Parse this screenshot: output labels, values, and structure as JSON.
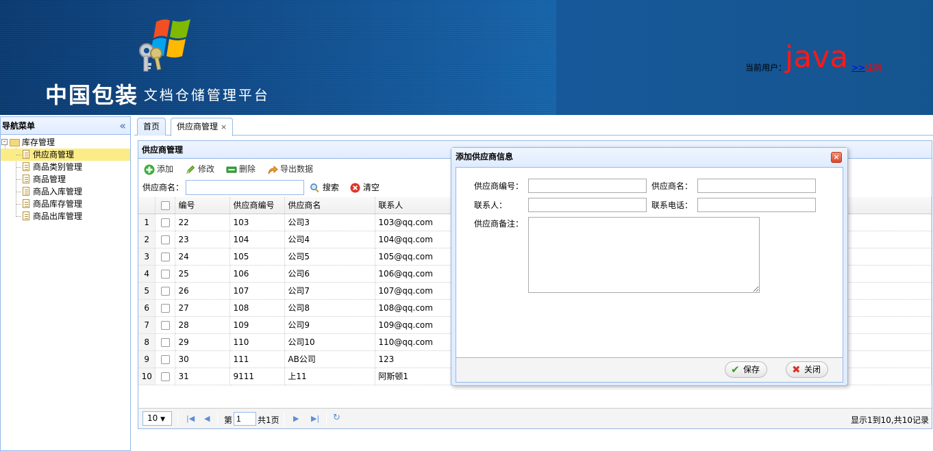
{
  "header": {
    "brand_big": "中国包装",
    "brand_small": "文档仓储管理平台",
    "user_label": "当前用户：",
    "user_name": "java",
    "logout_arrow": ">>",
    "logout_text": "注销"
  },
  "sidebar": {
    "title": "导航菜单",
    "collapse_icon": "double-chevron-left-icon",
    "root": {
      "label": "库存管理",
      "toggle": "-"
    },
    "items": [
      {
        "label": "供应商管理",
        "selected": true
      },
      {
        "label": "商品类别管理"
      },
      {
        "label": "商品管理"
      },
      {
        "label": "商品入库管理"
      },
      {
        "label": "商品库存管理"
      },
      {
        "label": "商品出库管理"
      }
    ]
  },
  "tabs": [
    {
      "label": "首页"
    },
    {
      "label": "供应商管理",
      "closable": "×"
    }
  ],
  "panel": {
    "title": "供应商管理",
    "toolbar": {
      "add": "添加",
      "edit": "修改",
      "delete": "删除",
      "export": "导出数据"
    },
    "search": {
      "label": "供应商名：",
      "value": "",
      "search_btn": "搜索",
      "clear_btn": "清空"
    }
  },
  "grid": {
    "columns": [
      "编号",
      "供应商编号",
      "供应商名",
      "联系人"
    ],
    "rows": [
      {
        "rn": "1",
        "id": "22",
        "code": "103",
        "name": "公司3",
        "contact": "103@qq.com"
      },
      {
        "rn": "2",
        "id": "23",
        "code": "104",
        "name": "公司4",
        "contact": "104@qq.com"
      },
      {
        "rn": "3",
        "id": "24",
        "code": "105",
        "name": "公司5",
        "contact": "105@qq.com"
      },
      {
        "rn": "4",
        "id": "25",
        "code": "106",
        "name": "公司6",
        "contact": "106@qq.com"
      },
      {
        "rn": "5",
        "id": "26",
        "code": "107",
        "name": "公司7",
        "contact": "107@qq.com"
      },
      {
        "rn": "6",
        "id": "27",
        "code": "108",
        "name": "公司8",
        "contact": "108@qq.com"
      },
      {
        "rn": "7",
        "id": "28",
        "code": "109",
        "name": "公司9",
        "contact": "109@qq.com"
      },
      {
        "rn": "8",
        "id": "29",
        "code": "110",
        "name": "公司10",
        "contact": "110@qq.com"
      },
      {
        "rn": "9",
        "id": "30",
        "code": "111",
        "name": "AB公司",
        "contact": "123"
      },
      {
        "rn": "10",
        "id": "31",
        "code": "9111",
        "name": "上11",
        "contact": "阿斯顿1"
      }
    ]
  },
  "pager": {
    "page_size": "10",
    "page_prefix": "第",
    "page_value": "1",
    "page_total": "共1页",
    "info": "显示1到10,共10记录"
  },
  "dialog": {
    "title": "添加供应商信息",
    "close_icon": "close-icon",
    "fields": {
      "code_label": "供应商编号：",
      "code_value": "",
      "name_label": "供应商名：",
      "name_value": "",
      "contact_label": "联系人：",
      "contact_value": "",
      "phone_label": "联系电话：",
      "phone_value": "",
      "remark_label": "供应商备注：",
      "remark_value": ""
    },
    "save_btn": "保存",
    "close_btn": "关闭"
  },
  "colors": {
    "header_bg": "#13508f",
    "panel_border": "#95b8e7",
    "selected_item": "#fbec88",
    "user_name": "#ff1818",
    "logout_text": "#ff0000"
  }
}
